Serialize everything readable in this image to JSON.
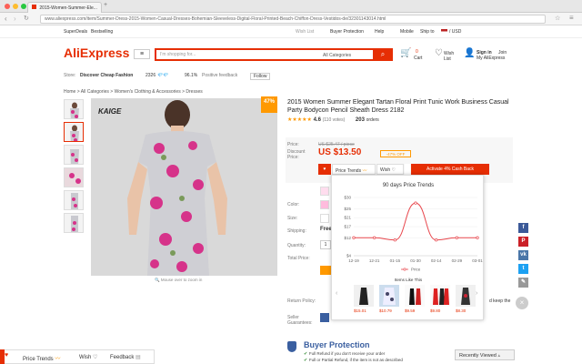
{
  "browser": {
    "tab_title": "2015-Women-Summer-Ele...",
    "tab_close": "×",
    "url": "www.aliexpress.com/item/Summer-Dress-2015-Women-Casual-Dresses-Bohemian-Sleeveless-Digital-Floral-Printed-Beach-Chiffon-Dress-Vestidos-de/32301143014.html"
  },
  "topnav": {
    "super_deals": "SuperDeals",
    "bestselling": "Bestselling",
    "wish_list": "Wish List",
    "buyer_protection": "Buyer Protection",
    "help": "Help",
    "mobile": "Mobile",
    "ship_to": "Ship to",
    "currency": "/ USD"
  },
  "header": {
    "logo": "AliExpress",
    "search_placeholder": "I'm shopping for...",
    "all_categories": "All Categories",
    "cart_count": "0",
    "cart_label": "Cart",
    "wish_label": "Wish List",
    "signin": "Sign in",
    "join": "Join",
    "my_ali": "My AliExpress"
  },
  "store": {
    "label": "Store:",
    "name": "Discover Cheap Fashion",
    "score": "2326",
    "feedback_pct": "96.1%",
    "feedback_label": "Positive feedback",
    "follow": "Follow"
  },
  "breadcrumb": "Home > All Categories > Women's Clothing & Accessories > Dresses",
  "product": {
    "brand_text": "KAIGE",
    "discount": "47%",
    "zoom_hint": "Mouse over to zoom in",
    "title": "2015 Women Summer Elegant Tartan Floral Print Tunic Work Business Casual Party Bodycon Pencil Sheath Dress 2182",
    "rating": "4.6",
    "votes": "(110 votes)",
    "orders_count": "203",
    "orders_label": "orders",
    "price_label": "Price:",
    "discount_label": "Discount Price:",
    "old_price": "US $25.47 / piece",
    "new_price": "US $13.50",
    "discount_tag": "-47% OFF",
    "color_label": "Color:",
    "size_label": "Size:",
    "shipping_label": "Shipping:",
    "shipping_value": "Free",
    "quantity_label": "Quantity:",
    "quantity_value": "1",
    "total_label": "Total Price:",
    "return_label": "Return Policy:",
    "return_note": "d keep the",
    "seller_label": "Seller Guarantees:"
  },
  "extension": {
    "price_trends": "Price Trends",
    "wish": "Wish",
    "cashback": "Activate 4% Cash Back",
    "feedback": "Feedback"
  },
  "popup": {
    "title": "90 days Price Trends",
    "items_title": "Items Like This",
    "item_prices": [
      "$15.01",
      "$10.79",
      "$9.59",
      "$9.80",
      "$8.30"
    ]
  },
  "chart_data": {
    "type": "line",
    "title": "90 days Price Trends",
    "x": [
      "12-19",
      "12-21",
      "01-15",
      "01-30",
      "02-14",
      "02-29",
      "03-01"
    ],
    "series": [
      {
        "name": "Price",
        "values": [
          12,
          12,
          11,
          27.5,
          11,
          12,
          12
        ]
      }
    ],
    "y_ticks": [
      "$4",
      "$12",
      "$17",
      "$21",
      "$25",
      "$30"
    ],
    "ylim": [
      4,
      30
    ],
    "legend": "bottom-center",
    "line_color": "#e8474d"
  },
  "buyer_protection": {
    "title": "Buyer Protection",
    "line1": "Full Refund if you don't receive your order",
    "line2": "Full or Partial Refund, if the item is not as described"
  },
  "recently_viewed": "Recently Viewed",
  "colors": {
    "brand": "#e62e04",
    "cashback": "#e62e04",
    "line": "#e8474d"
  }
}
